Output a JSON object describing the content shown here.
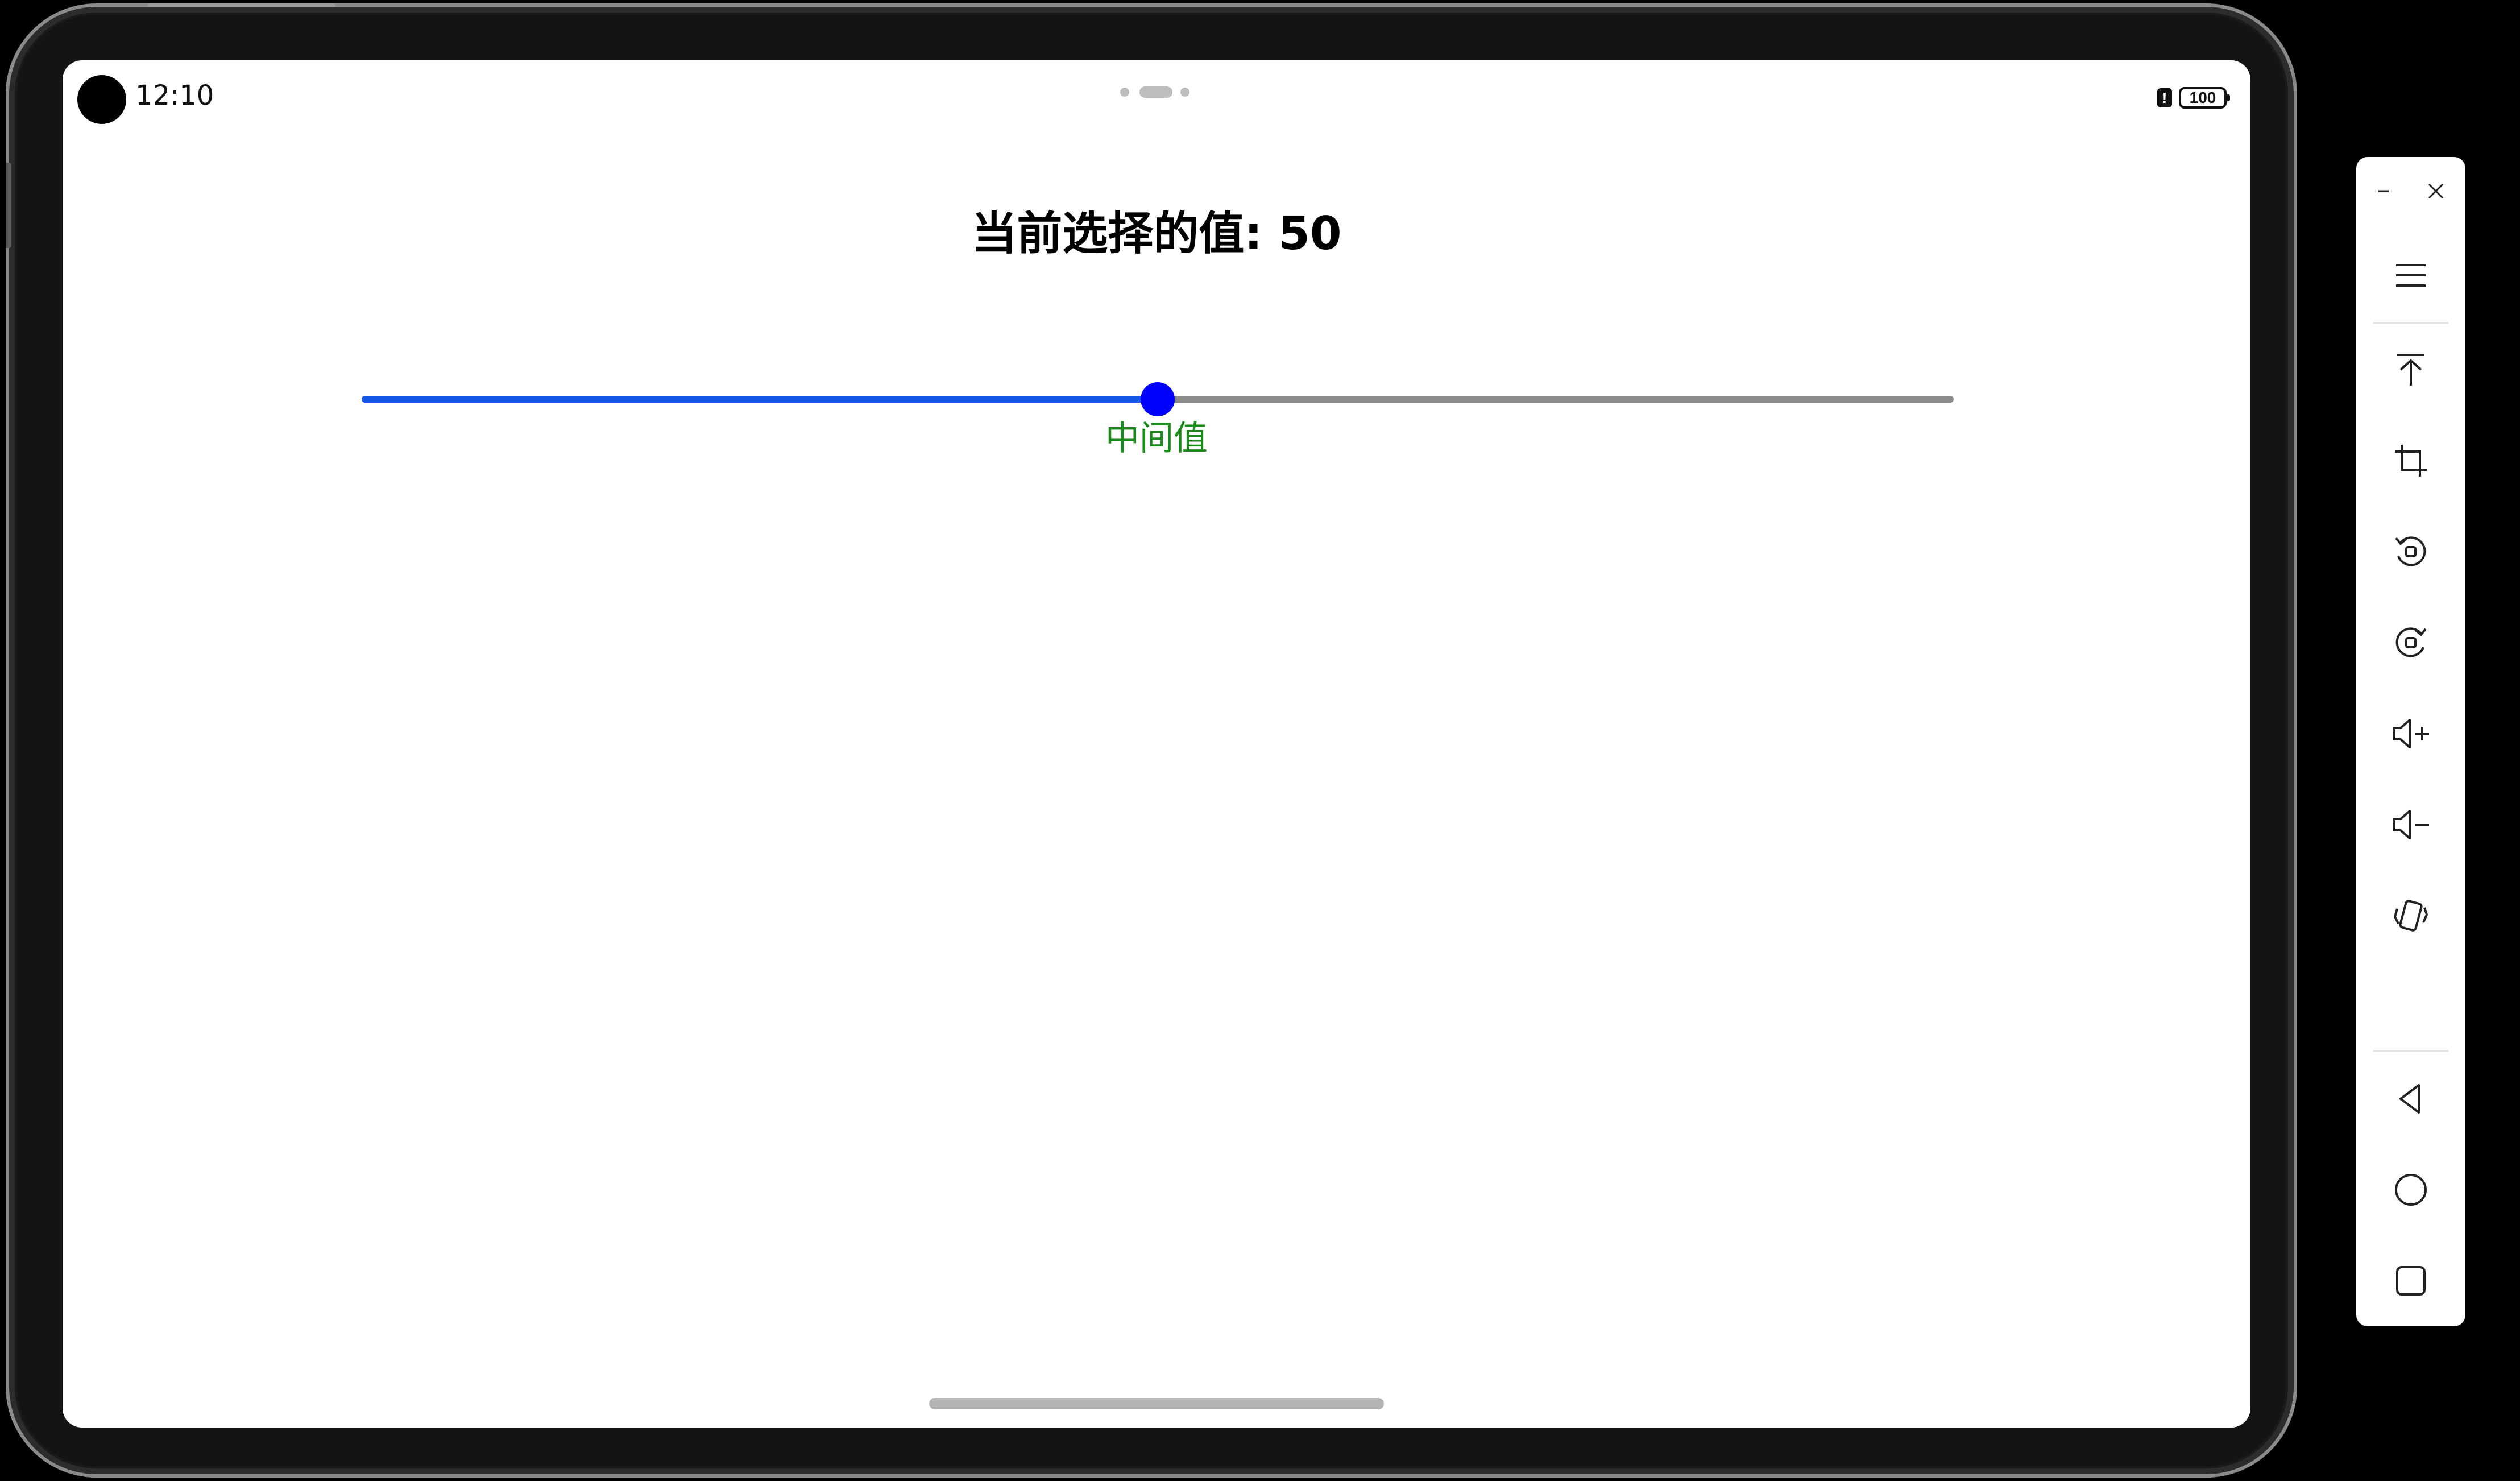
{
  "status_bar": {
    "time": "12:10",
    "battery_level": "100",
    "alert_symbol": "!"
  },
  "app": {
    "title": "当前选择的值: 50",
    "slider": {
      "value": 50,
      "min": 0,
      "max": 100,
      "fill_color": "#1456e6",
      "thumb_color": "#0000ff",
      "track_color": "#8c8c8c"
    },
    "hint_label": "中间值",
    "hint_color": "#1a8a1a"
  },
  "toolbar": {
    "icons": [
      "minimize-icon",
      "close-icon",
      "menu-icon",
      "pin-to-top-icon",
      "crop-icon",
      "rotate-left-icon",
      "rotate-right-icon",
      "volume-up-icon",
      "volume-down-icon",
      "shake-icon",
      "back-icon",
      "home-icon",
      "recents-icon"
    ]
  }
}
